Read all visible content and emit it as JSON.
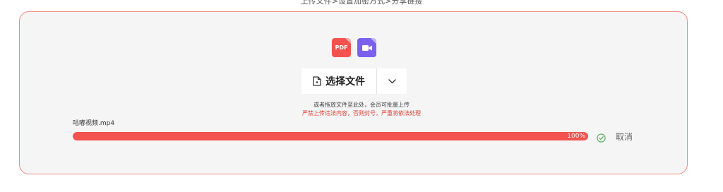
{
  "header": {
    "steps": "上传文件>设置加密方式>分享链接"
  },
  "upload": {
    "file_icons": [
      {
        "icon": "pdf-file-icon",
        "label": "PDF",
        "color": "#f4524e"
      },
      {
        "icon": "video-file-icon",
        "color": "#7b61ee"
      }
    ],
    "select_label": "选择文件",
    "hint_primary": "或者拖放文件至此处，会员可批量上传",
    "hint_warning": "严禁上传违法内容，否则封号，严重将依法处理",
    "accent_color": "#f4524e",
    "border_color": "#f08a7c"
  },
  "file": {
    "name": "咕嘟视频.mp4",
    "progress": 100,
    "progress_text": "100%",
    "status_icon": "check-circle-icon",
    "cancel_label": "取消"
  }
}
